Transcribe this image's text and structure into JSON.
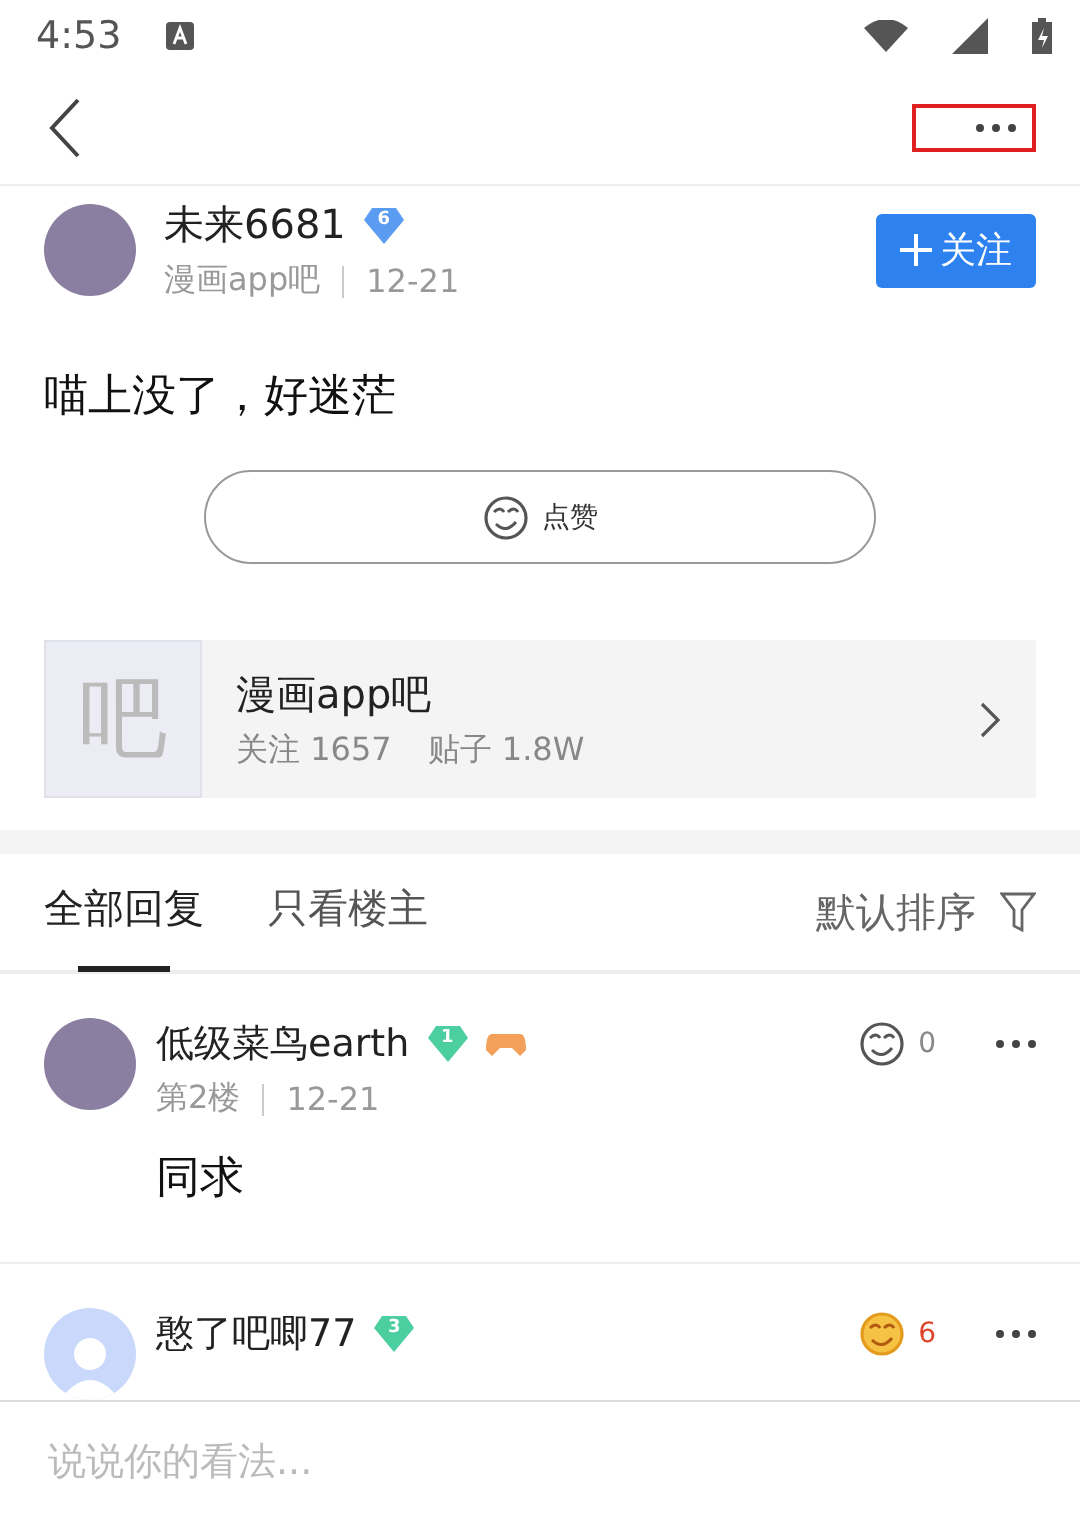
{
  "status_bar": {
    "time": "4:53"
  },
  "post": {
    "author": "未来6681",
    "level": "6",
    "color": "#5b9cf0",
    "forum": "漫画app吧",
    "date": "12-21",
    "follow_label": "关注",
    "content": "喵上没了，好迷茫",
    "like_label": "点赞"
  },
  "forum_card": {
    "glyph": "吧",
    "name": "漫画app吧",
    "followers": "关注 1657",
    "posts": "贴子 1.8W"
  },
  "tabs": [
    {
      "label": "全部回复",
      "selected": true
    },
    {
      "label": "只看楼主",
      "selected": false
    }
  ],
  "sort": {
    "label": "默认排序"
  },
  "replies": [
    {
      "author": "低级菜鸟earth",
      "kind": "photo",
      "level": "1",
      "color": "#4ccfa0",
      "game_badge": true,
      "floor": "第2楼",
      "date": "12-21",
      "likes": "0",
      "liked": false,
      "content": "同求"
    },
    {
      "author": "憨了吧唧77",
      "kind": "default",
      "level": "3",
      "color": "#4ccfa0",
      "game_badge": false,
      "likes": "6",
      "liked": true
    }
  ],
  "comment_box": {
    "placeholder": "说说你的看法..."
  }
}
